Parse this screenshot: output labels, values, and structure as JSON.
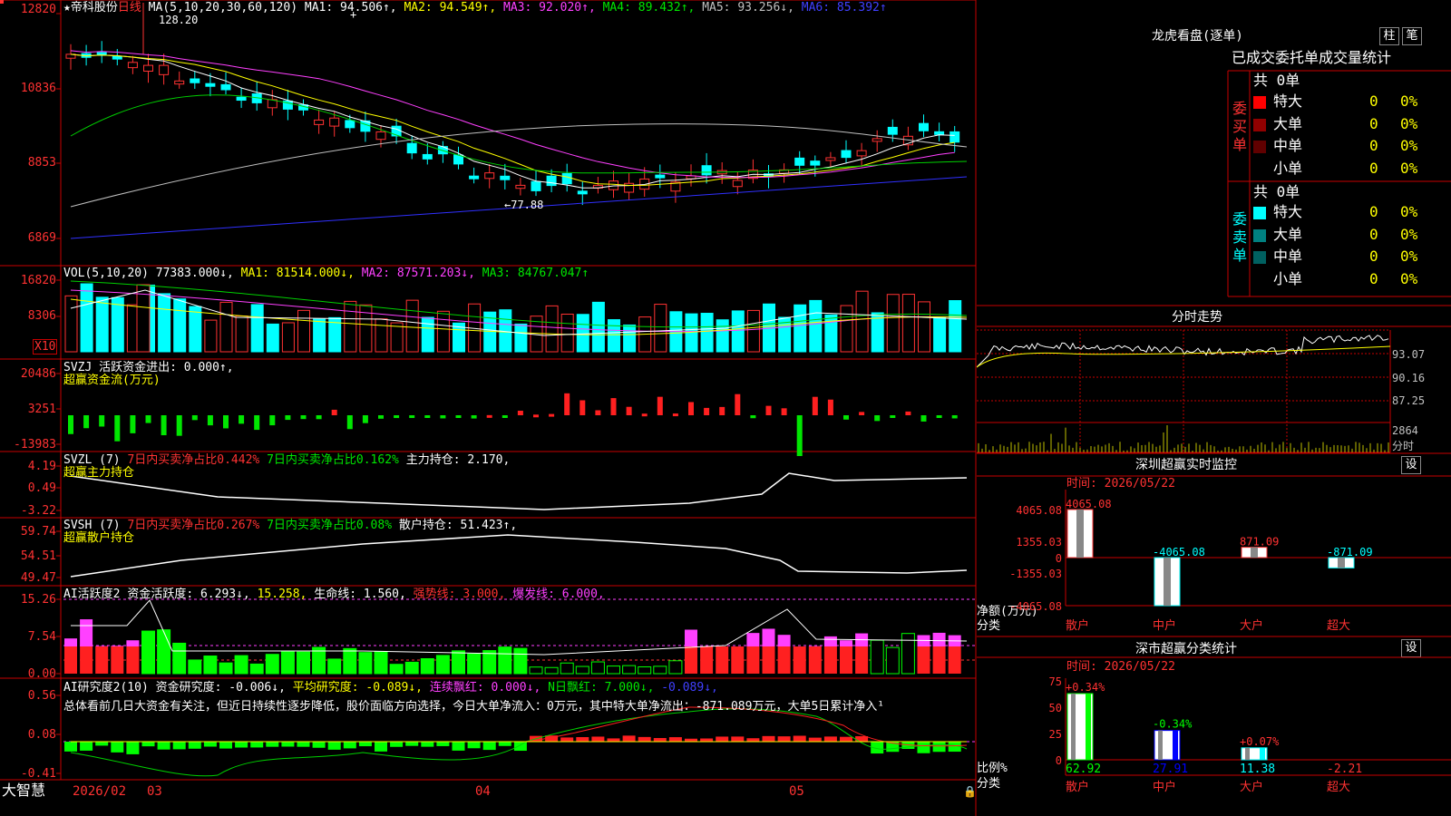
{
  "colors": {
    "up": "#ff3232",
    "down": "#00ffff",
    "grid": "#c80000",
    "yellow": "#ffff00",
    "magenta": "#ff40ff",
    "green": "#00e600",
    "blue": "#3030ff",
    "white": "#ffffff"
  },
  "kline": {
    "title": "★帝科股份",
    "period": "日线",
    "ma_label": "MA(5,10,20,30,60,120)",
    "ma1": "MA1: 94.506↑,",
    "ma2": "MA2: 94.549↑,",
    "ma3": "MA3: 92.020↑,",
    "ma4": "MA4: 89.432↑,",
    "ma5": "MA5: 93.256↓,",
    "ma6": "MA6: 85.392↑",
    "high_mark": "128.20",
    "low_mark": "←77.88",
    "yticks": [
      "12820",
      "10836",
      "8853",
      "6869"
    ]
  },
  "vol": {
    "label": "VOL(5,10,20)",
    "v": "77383.000↓,",
    "ma1": "MA1: 81514.000↓,",
    "ma2": "MA2: 87571.203↓,",
    "ma3": "MA3: 84767.047↑",
    "yticks": [
      "16820",
      "8306"
    ],
    "unit": "X10"
  },
  "svzj": {
    "label": "SVZJ  活跃资金进出: 0.000↑,",
    "sub": "超赢资金流(万元)",
    "yticks": [
      "20486",
      "3251",
      "-13983"
    ]
  },
  "svzl": {
    "label": "SVZL (7)",
    "a": "7日内买卖净占比0.442%",
    "b": "7日内买卖净占比0.162%",
    "c": "主力持仓: 2.170,",
    "sub": "超赢主力持仓",
    "yticks": [
      "4.19",
      "0.49",
      "-3.22"
    ]
  },
  "svsh": {
    "label": "SVSH (7)",
    "a": "7日内买卖净占比0.267%",
    "b": "7日内买卖净占比0.08%",
    "c": "散户持仓: 51.423↑,",
    "sub": "超赢散户持仓",
    "yticks": [
      "59.74",
      "54.51",
      "49.47"
    ]
  },
  "ai1": {
    "label": "AI活跃度2",
    "a": "资金活跃度: 6.293↓,",
    "b": "15.258,",
    "c": "生命线: 1.560,",
    "d": "强势线: 3.000,",
    "e": "爆发线: 6.000,",
    "yticks": [
      "15.26",
      "7.54",
      "0.00"
    ]
  },
  "ai2": {
    "label": "AI研究度2(10)",
    "a": "资金研究度: -0.006↓,",
    "b": "平均研究度: -0.089↓,",
    "c": "连续飘红: 0.000↓,",
    "d": "N日飘红: 7.000↓,",
    "e": "-0.089↓,",
    "text": "总体看前几日大资金有关注，但近日持续性逐步降低，股价面临方向选择，今日大单净流入：0万元，其中特大单净流出：-871.089万元，大单5日累计净入¹",
    "yticks": [
      "0.56",
      "0.08",
      "-0.41"
    ]
  },
  "xaxis": {
    "brand": "大智慧",
    "labels": [
      "2026/02",
      "03",
      "04",
      "05"
    ]
  },
  "dragon": {
    "title": "龙虎看盘(逐单)",
    "btn_bar": "柱",
    "btn_pen": "笔",
    "subtitle": "已成交委托单成交量统计",
    "buy_title": "委买单",
    "buy_total": "共 0单",
    "buy_rows": [
      {
        "n": "特大",
        "v": "0",
        "p": "0%",
        "c": "#ff0000"
      },
      {
        "n": "大单",
        "v": "0",
        "p": "0%",
        "c": "#900000"
      },
      {
        "n": "中单",
        "v": "0",
        "p": "0%",
        "c": "#600000"
      },
      {
        "n": "小单",
        "v": "0",
        "p": "0%",
        "c": ""
      }
    ],
    "sell_title": "委卖单",
    "sell_total": "共 0单",
    "sell_rows": [
      {
        "n": "特大",
        "v": "0",
        "p": "0%",
        "c": "#00ffff"
      },
      {
        "n": "大单",
        "v": "0",
        "p": "0%",
        "c": "#008080"
      },
      {
        "n": "中单",
        "v": "0",
        "p": "0%",
        "c": "#006060"
      },
      {
        "n": "小单",
        "v": "0",
        "p": "0%",
        "c": ""
      }
    ]
  },
  "intraday": {
    "title": "分时走势",
    "yticks": [
      "93.07",
      "90.16",
      "87.25"
    ],
    "vol_tick": "2864",
    "vol_label": "分时"
  },
  "sz_monitor": {
    "title": "深圳超赢实时监控",
    "btn": "设",
    "time": "时间: 2026/05/22",
    "yticks": [
      "4065.08",
      "1355.03",
      "0",
      "-1355.03",
      "-4065.08"
    ],
    "ylabel": "净额(万元)",
    "xlabel": "分类",
    "chart_data": {
      "type": "bar",
      "categories": [
        "散户",
        "中户",
        "大户",
        "超大"
      ],
      "values": [
        4065.08,
        -4065.08,
        871.09,
        -871.09
      ],
      "value_labels": [
        "4065.08",
        "-4065.08",
        "871.09",
        "-871.09"
      ],
      "ylim": [
        -4065.08,
        4065.08
      ]
    }
  },
  "sz_class": {
    "title": "深市超赢分类统计",
    "btn": "设",
    "time": "时间: 2026/05/22",
    "yticks": [
      "75",
      "50",
      "25",
      "0"
    ],
    "ylabel": "比例%",
    "xlabel": "分类",
    "chart_data": {
      "type": "bar",
      "categories": [
        "散户",
        "中户",
        "大户",
        "超大"
      ],
      "values": [
        62.92,
        27.91,
        11.38,
        -2.21
      ],
      "pct_labels": [
        "+0.34%",
        "-0.34%",
        "+0.07%",
        ""
      ],
      "value_labels": [
        "62.92",
        "27.91",
        "11.38",
        "-2.21"
      ],
      "ylim": [
        0,
        75
      ]
    }
  }
}
